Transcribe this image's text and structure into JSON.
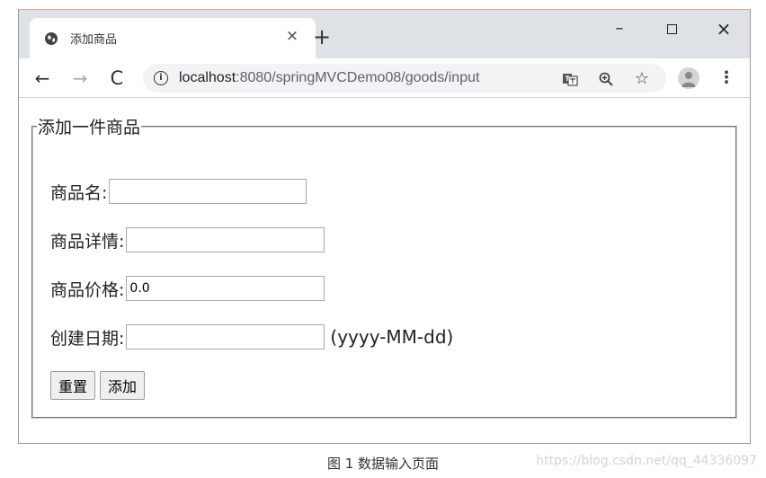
{
  "tab": {
    "title": "添加商品",
    "close_glyph": "×",
    "new_tab_glyph": "+"
  },
  "window_controls": {
    "minimize": "–",
    "close": "×"
  },
  "nav": {
    "back": "←",
    "forward": "→",
    "reload": "C"
  },
  "address": {
    "host": "localhost",
    "rest": ":8080/springMVCDemo08/goods/input",
    "info_glyph": "i"
  },
  "toolbar_icons": {
    "star": "☆",
    "menu": "⋮"
  },
  "form": {
    "legend": "添加一件商品",
    "fields": [
      {
        "label": "商品名:",
        "value": ""
      },
      {
        "label": "商品详情:",
        "value": ""
      },
      {
        "label": "商品价格:",
        "value": "0.0"
      },
      {
        "label": "创建日期:",
        "value": "",
        "hint": "(yyyy-MM-dd)"
      }
    ],
    "buttons": {
      "reset": "重置",
      "submit": "添加"
    }
  },
  "caption": "图 1  数据输入页面",
  "watermark": "https://blog.csdn.net/qq_44336097",
  "colors": {
    "tabstrip": "#dee1e6",
    "omnibox": "#f1f3f4",
    "accent_border": "#e8a090"
  }
}
